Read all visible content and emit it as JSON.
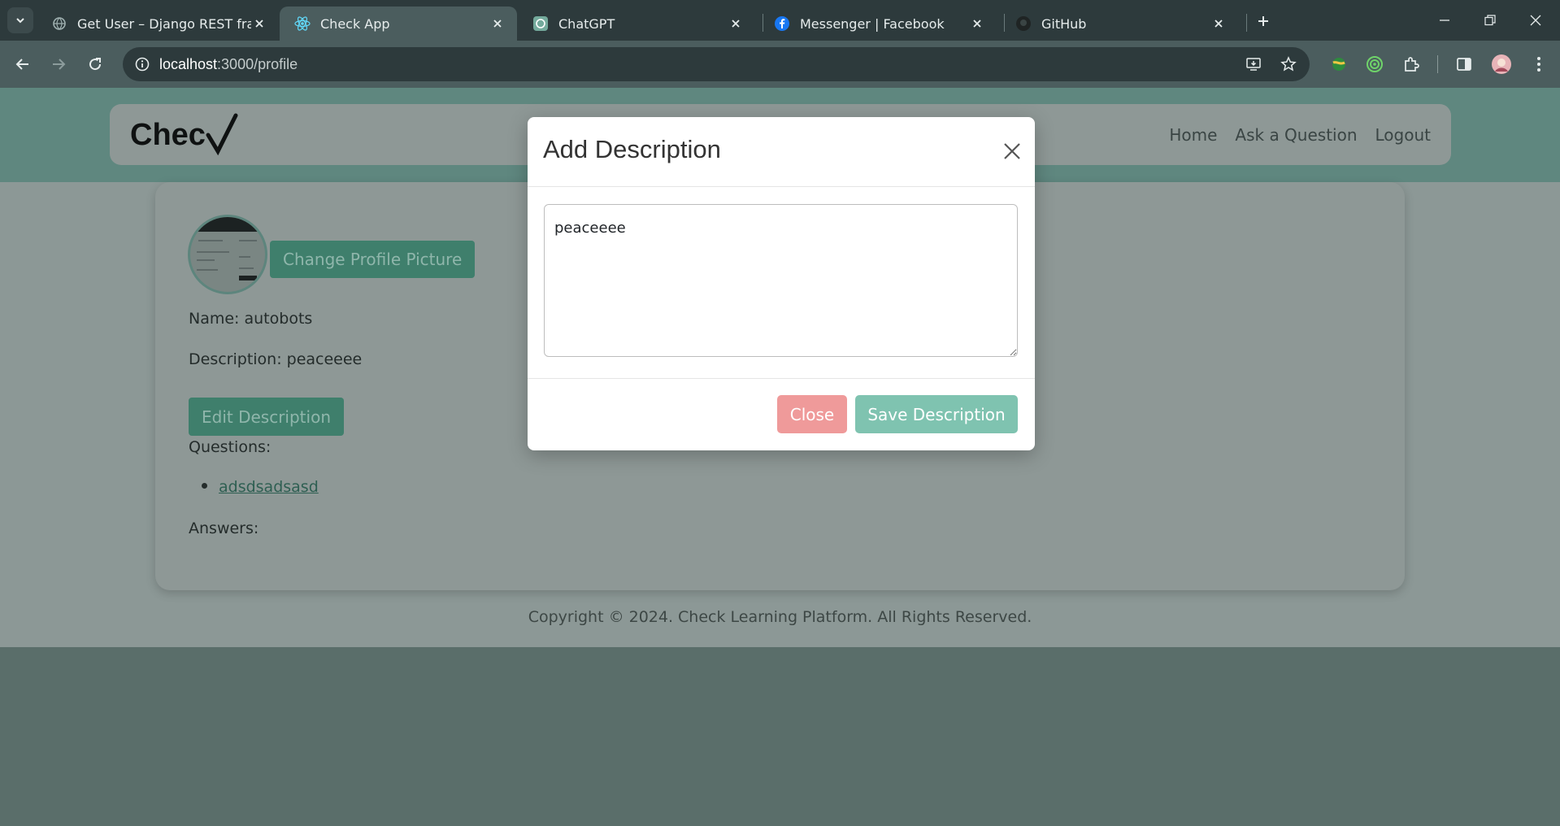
{
  "browser": {
    "tabs": [
      {
        "title": "Get User – Django REST framew",
        "icon": "globe-icon"
      },
      {
        "title": "Check App",
        "icon": "react-icon"
      },
      {
        "title": "ChatGPT",
        "icon": "chatgpt-icon"
      },
      {
        "title": "Messenger | Facebook",
        "icon": "facebook-icon"
      },
      {
        "title": "GitHub",
        "icon": "github-icon"
      }
    ],
    "active_tab": 1,
    "url_host": "localhost",
    "url_path": ":3000/profile"
  },
  "navbar": {
    "logo": "Chec",
    "links": [
      "Home",
      "Ask a Question",
      "Logout"
    ]
  },
  "profile": {
    "change_picture_label": "Change Profile Picture",
    "name_line": "Name: autobots",
    "description_line": "Description: peaceeee",
    "edit_description_label": "Edit Description",
    "questions_label": "Questions:",
    "questions": [
      "adsdsadsasd"
    ],
    "answers_label": "Answers:"
  },
  "footer": {
    "text": "Copyright © 2024. Check Learning Platform. All Rights Reserved."
  },
  "modal": {
    "title": "Add Description",
    "textarea_value": "peaceeee",
    "close_label": "Close",
    "save_label": "Save Description"
  },
  "colors": {
    "primary": "#7fc3b0",
    "danger": "#ef9a9a",
    "chrome_dark": "#2d3a3c",
    "chrome_mid": "#4b5d5e"
  }
}
